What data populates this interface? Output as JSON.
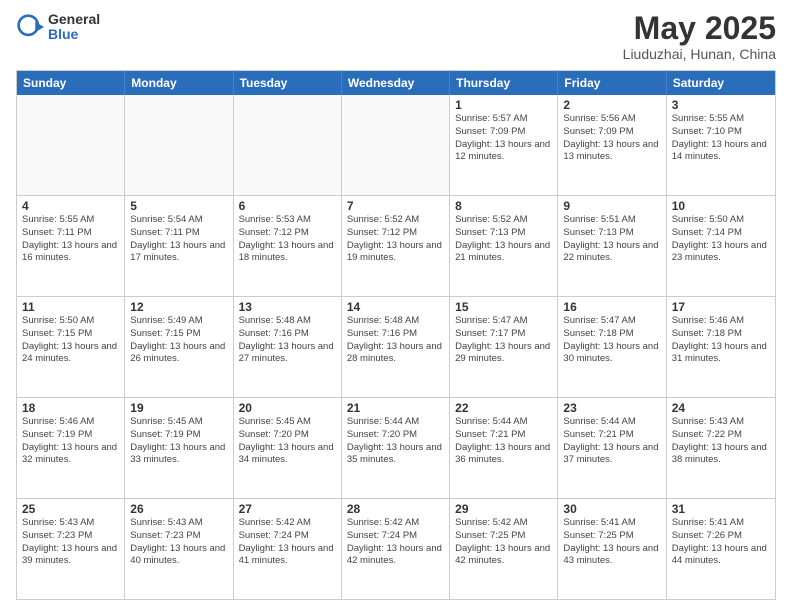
{
  "logo": {
    "general": "General",
    "blue": "Blue"
  },
  "title": "May 2025",
  "subtitle": "Liuduzhai, Hunan, China",
  "days_of_week": [
    "Sunday",
    "Monday",
    "Tuesday",
    "Wednesday",
    "Thursday",
    "Friday",
    "Saturday"
  ],
  "weeks": [
    [
      {
        "day": "",
        "empty": true
      },
      {
        "day": "",
        "empty": true
      },
      {
        "day": "",
        "empty": true
      },
      {
        "day": "",
        "empty": true
      },
      {
        "day": "1",
        "sunrise": "5:57 AM",
        "sunset": "7:09 PM",
        "daylight": "13 hours and 12 minutes."
      },
      {
        "day": "2",
        "sunrise": "5:56 AM",
        "sunset": "7:09 PM",
        "daylight": "13 hours and 13 minutes."
      },
      {
        "day": "3",
        "sunrise": "5:55 AM",
        "sunset": "7:10 PM",
        "daylight": "13 hours and 14 minutes."
      }
    ],
    [
      {
        "day": "4",
        "sunrise": "5:55 AM",
        "sunset": "7:11 PM",
        "daylight": "13 hours and 16 minutes."
      },
      {
        "day": "5",
        "sunrise": "5:54 AM",
        "sunset": "7:11 PM",
        "daylight": "13 hours and 17 minutes."
      },
      {
        "day": "6",
        "sunrise": "5:53 AM",
        "sunset": "7:12 PM",
        "daylight": "13 hours and 18 minutes."
      },
      {
        "day": "7",
        "sunrise": "5:52 AM",
        "sunset": "7:12 PM",
        "daylight": "13 hours and 19 minutes."
      },
      {
        "day": "8",
        "sunrise": "5:52 AM",
        "sunset": "7:13 PM",
        "daylight": "13 hours and 21 minutes."
      },
      {
        "day": "9",
        "sunrise": "5:51 AM",
        "sunset": "7:13 PM",
        "daylight": "13 hours and 22 minutes."
      },
      {
        "day": "10",
        "sunrise": "5:50 AM",
        "sunset": "7:14 PM",
        "daylight": "13 hours and 23 minutes."
      }
    ],
    [
      {
        "day": "11",
        "sunrise": "5:50 AM",
        "sunset": "7:15 PM",
        "daylight": "13 hours and 24 minutes."
      },
      {
        "day": "12",
        "sunrise": "5:49 AM",
        "sunset": "7:15 PM",
        "daylight": "13 hours and 26 minutes."
      },
      {
        "day": "13",
        "sunrise": "5:48 AM",
        "sunset": "7:16 PM",
        "daylight": "13 hours and 27 minutes."
      },
      {
        "day": "14",
        "sunrise": "5:48 AM",
        "sunset": "7:16 PM",
        "daylight": "13 hours and 28 minutes."
      },
      {
        "day": "15",
        "sunrise": "5:47 AM",
        "sunset": "7:17 PM",
        "daylight": "13 hours and 29 minutes."
      },
      {
        "day": "16",
        "sunrise": "5:47 AM",
        "sunset": "7:18 PM",
        "daylight": "13 hours and 30 minutes."
      },
      {
        "day": "17",
        "sunrise": "5:46 AM",
        "sunset": "7:18 PM",
        "daylight": "13 hours and 31 minutes."
      }
    ],
    [
      {
        "day": "18",
        "sunrise": "5:46 AM",
        "sunset": "7:19 PM",
        "daylight": "13 hours and 32 minutes."
      },
      {
        "day": "19",
        "sunrise": "5:45 AM",
        "sunset": "7:19 PM",
        "daylight": "13 hours and 33 minutes."
      },
      {
        "day": "20",
        "sunrise": "5:45 AM",
        "sunset": "7:20 PM",
        "daylight": "13 hours and 34 minutes."
      },
      {
        "day": "21",
        "sunrise": "5:44 AM",
        "sunset": "7:20 PM",
        "daylight": "13 hours and 35 minutes."
      },
      {
        "day": "22",
        "sunrise": "5:44 AM",
        "sunset": "7:21 PM",
        "daylight": "13 hours and 36 minutes."
      },
      {
        "day": "23",
        "sunrise": "5:44 AM",
        "sunset": "7:21 PM",
        "daylight": "13 hours and 37 minutes."
      },
      {
        "day": "24",
        "sunrise": "5:43 AM",
        "sunset": "7:22 PM",
        "daylight": "13 hours and 38 minutes."
      }
    ],
    [
      {
        "day": "25",
        "sunrise": "5:43 AM",
        "sunset": "7:23 PM",
        "daylight": "13 hours and 39 minutes."
      },
      {
        "day": "26",
        "sunrise": "5:43 AM",
        "sunset": "7:23 PM",
        "daylight": "13 hours and 40 minutes."
      },
      {
        "day": "27",
        "sunrise": "5:42 AM",
        "sunset": "7:24 PM",
        "daylight": "13 hours and 41 minutes."
      },
      {
        "day": "28",
        "sunrise": "5:42 AM",
        "sunset": "7:24 PM",
        "daylight": "13 hours and 42 minutes."
      },
      {
        "day": "29",
        "sunrise": "5:42 AM",
        "sunset": "7:25 PM",
        "daylight": "13 hours and 42 minutes."
      },
      {
        "day": "30",
        "sunrise": "5:41 AM",
        "sunset": "7:25 PM",
        "daylight": "13 hours and 43 minutes."
      },
      {
        "day": "31",
        "sunrise": "5:41 AM",
        "sunset": "7:26 PM",
        "daylight": "13 hours and 44 minutes."
      }
    ]
  ]
}
